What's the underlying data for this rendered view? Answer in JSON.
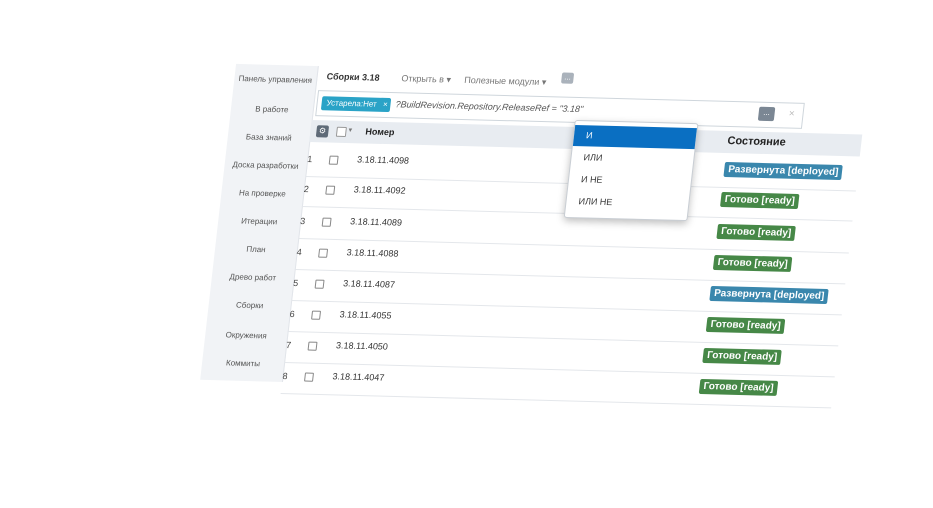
{
  "sidebar": {
    "items": [
      {
        "label": "Панель управления"
      },
      {
        "label": "В работе"
      },
      {
        "label": "База знаний"
      },
      {
        "label": "Доска разработки"
      },
      {
        "label": "На проверке"
      },
      {
        "label": "Итерации"
      },
      {
        "label": "План"
      },
      {
        "label": "Древо работ"
      },
      {
        "label": "Сборки"
      },
      {
        "label": "Окружения"
      },
      {
        "label": "Коммиты"
      }
    ]
  },
  "topbar": {
    "title": "Сборки 3.18",
    "open_in": "Открыть в ▾",
    "modules": "Полезные модули ▾",
    "dots": "..."
  },
  "filter": {
    "chip_label": "Устарела:Нет",
    "chip_close": "×",
    "query": "?BuildRevision.Repository.ReleaseRef = \"3.18\"",
    "more": "...",
    "close": "×"
  },
  "table": {
    "gear": "⚙",
    "caret": "▾",
    "col_number": "Номер",
    "col_state": "Состояние",
    "rows": [
      {
        "idx": "1",
        "number": "3.18.11.4098",
        "state": "Развернута [deployed]",
        "kind": "deployed"
      },
      {
        "idx": "2",
        "number": "3.18.11.4092",
        "state": "Готово [ready]",
        "kind": "ready"
      },
      {
        "idx": "3",
        "number": "3.18.11.4089",
        "state": "Готово [ready]",
        "kind": "ready"
      },
      {
        "idx": "4",
        "number": "3.18.11.4088",
        "state": "Готово [ready]",
        "kind": "ready"
      },
      {
        "idx": "5",
        "number": "3.18.11.4087",
        "state": "Развернута [deployed]",
        "kind": "deployed"
      },
      {
        "idx": "6",
        "number": "3.18.11.4055",
        "state": "Готово [ready]",
        "kind": "ready"
      },
      {
        "idx": "7",
        "number": "3.18.11.4050",
        "state": "Готово [ready]",
        "kind": "ready"
      },
      {
        "idx": "8",
        "number": "3.18.11.4047",
        "state": "Готово [ready]",
        "kind": "ready"
      }
    ]
  },
  "dropdown": {
    "items": [
      {
        "label": "И"
      },
      {
        "label": "ИЛИ"
      },
      {
        "label": "И НЕ"
      },
      {
        "label": "ИЛИ НЕ"
      }
    ]
  },
  "colors": {
    "accent": "#2aa3c7",
    "deployed": "#3a87ad",
    "ready": "#468847",
    "dropdown_active": "#0a6fc2"
  }
}
